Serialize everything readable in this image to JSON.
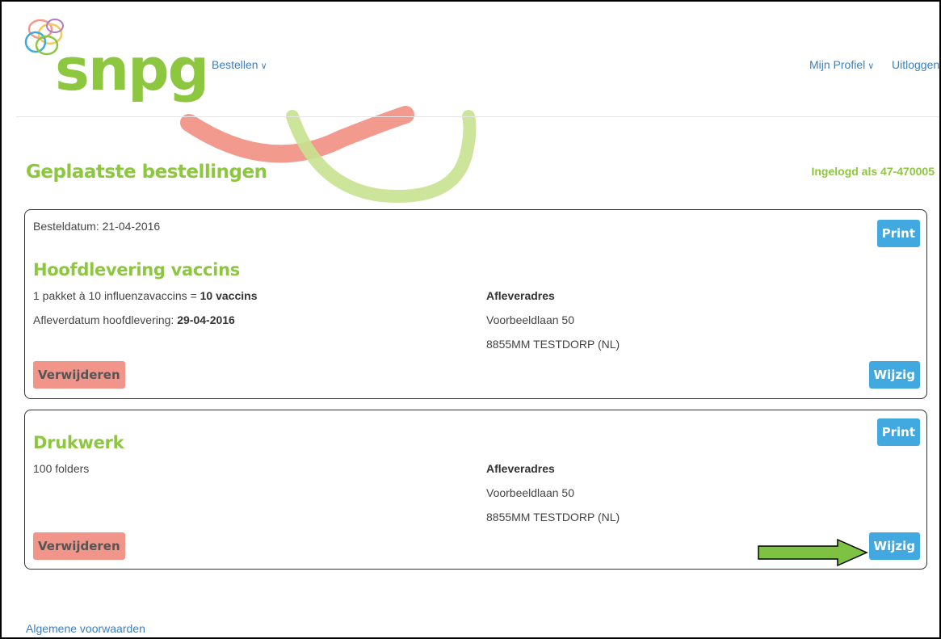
{
  "brand": {
    "name": "snpg",
    "color": "#8dc63f"
  },
  "nav": {
    "order_label": "Bestellen",
    "profile_label": "Mijn Profiel",
    "logout_label": "Uitloggen"
  },
  "page": {
    "title": "Geplaatste bestellingen",
    "logged_in": "Ingelogd als 47-470005"
  },
  "orders": [
    {
      "order_date": "Besteldatum: 21-04-2016",
      "title": "Hoofdlevering vaccins",
      "line1_prefix": "1 pakket à 10 influenzavaccins = ",
      "line1_bold": "10 vaccins",
      "line2_prefix": "Afleverdatum hoofdlevering: ",
      "line2_bold": "29-04-2016",
      "address_heading": "Afleveradres",
      "address_street": "Voorbeeldlaan 50",
      "address_city": "8855MM TESTDORP (NL)",
      "print_label": "Print",
      "delete_label": "Verwijderen",
      "edit_label": "Wijzig"
    },
    {
      "title": "Drukwerk",
      "line1": "100 folders",
      "address_heading": "Afleveradres",
      "address_street": "Voorbeeldlaan 50",
      "address_city": "8855MM TESTDORP (NL)",
      "print_label": "Print",
      "delete_label": "Verwijderen",
      "edit_label": "Wijzig"
    }
  ],
  "footer": {
    "terms_label": "Algemene voorwaarden"
  },
  "colors": {
    "accent_green": "#8dc63f",
    "button_blue": "#41a9df",
    "button_red": "#f1958a",
    "link_blue": "#3a7fc1",
    "arrow_green": "#7dc243"
  },
  "icons": {
    "dropdown": "chevron-down-icon",
    "callout": "arrow-right-icon"
  }
}
